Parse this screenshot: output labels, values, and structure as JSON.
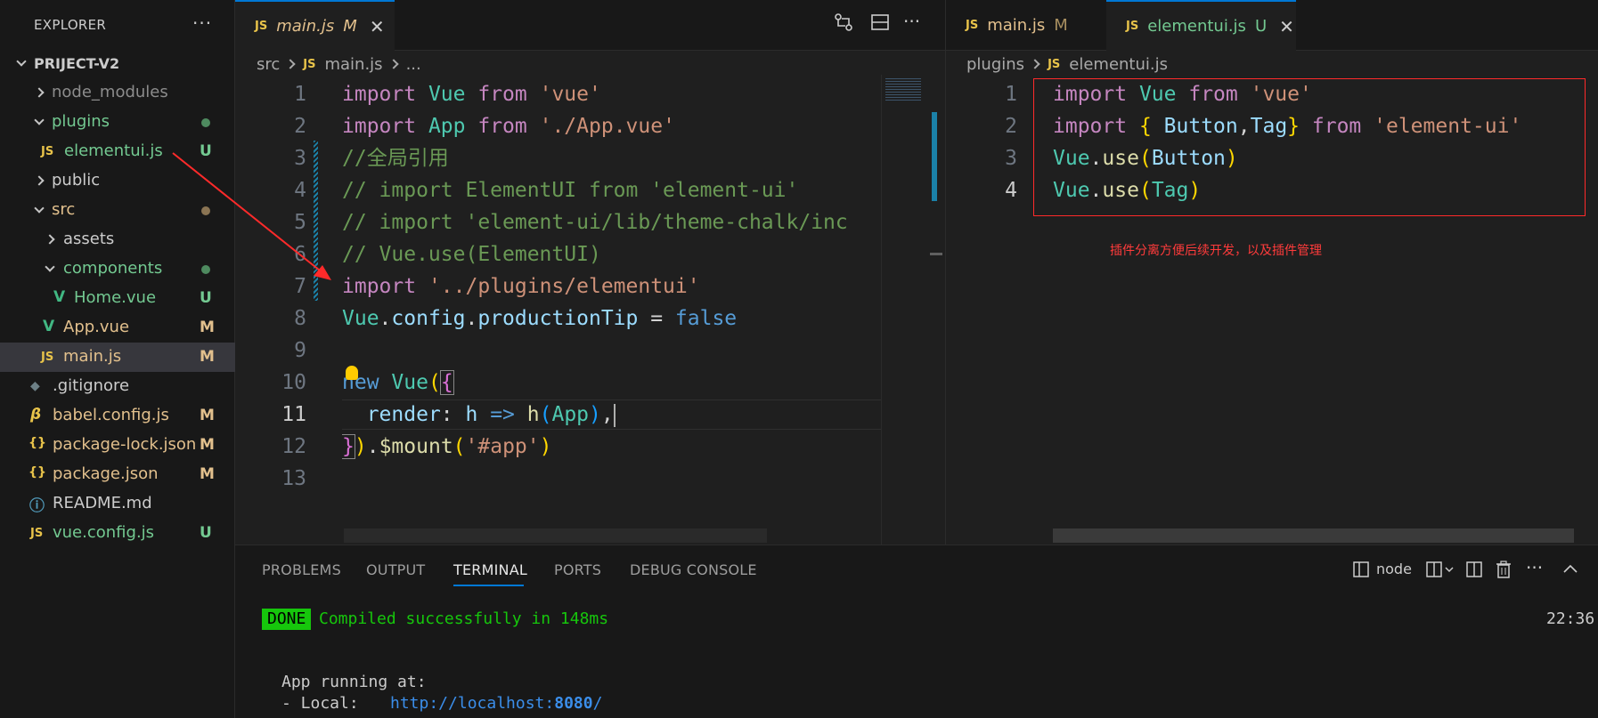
{
  "sidebar": {
    "title": "EXPLORER",
    "more": "···",
    "project": "PRIJECT-V2",
    "items": [
      {
        "label": "node_modules",
        "icon": "chevron-right",
        "status": ""
      },
      {
        "label": "plugins",
        "icon": "chevron-down",
        "status": ""
      },
      {
        "label": "elementui.js",
        "icon": "JS",
        "status": "U"
      },
      {
        "label": "public",
        "icon": "chevron-right",
        "status": ""
      },
      {
        "label": "src",
        "icon": "chevron-down",
        "status": ""
      },
      {
        "label": "assets",
        "icon": "chevron-right",
        "status": ""
      },
      {
        "label": "components",
        "icon": "chevron-down",
        "status": ""
      },
      {
        "label": "Home.vue",
        "icon": "V",
        "status": "U"
      },
      {
        "label": "App.vue",
        "icon": "V",
        "status": "M"
      },
      {
        "label": "main.js",
        "icon": "JS",
        "status": "M"
      },
      {
        "label": ".gitignore",
        "icon": "◆",
        "status": ""
      },
      {
        "label": "babel.config.js",
        "icon": "β",
        "status": "M"
      },
      {
        "label": "package-lock.json",
        "icon": "{}",
        "status": "M"
      },
      {
        "label": "package.json",
        "icon": "{}",
        "status": "M"
      },
      {
        "label": "README.md",
        "icon": "ⓘ",
        "status": ""
      },
      {
        "label": "vue.config.js",
        "icon": "JS",
        "status": "U"
      }
    ]
  },
  "editor1": {
    "tab": {
      "label": "main.js",
      "status": "M",
      "close": "✕",
      "icon": "JS"
    },
    "breadcrumb": {
      "folder": "src",
      "file": "main.js",
      "more": "..."
    },
    "line_numbers": [
      "1",
      "2",
      "3",
      "4",
      "5",
      "6",
      "7",
      "8",
      "9",
      "10",
      "11",
      "12",
      "13"
    ],
    "code": {
      "l1": [
        "import",
        "Vue",
        "from",
        "'vue'"
      ],
      "l2": [
        "import",
        "App",
        "from",
        "'./App.vue'"
      ],
      "l3": "//全局引用",
      "l4": "// import ElementUI from 'element-ui'",
      "l5": "// import 'element-ui/lib/theme-chalk/inc",
      "l6": "// Vue.use(ElementUI)",
      "l7": [
        "import",
        "'../plugins/elementui'"
      ],
      "l8": [
        "Vue",
        ".",
        "config",
        ".",
        "productionTip",
        " = ",
        "false"
      ],
      "l10": [
        "new",
        "Vue",
        "(",
        "{"
      ],
      "l11": [
        "render",
        ": ",
        "h",
        " => ",
        "h",
        "(",
        "App",
        ")",
        ","
      ],
      "l12": [
        "}",
        ")",
        ".",
        "$mount",
        "(",
        "'#app'",
        ")"
      ]
    }
  },
  "editor2": {
    "tabs": [
      {
        "label": "main.js",
        "status": "M",
        "icon": "JS"
      },
      {
        "label": "elementui.js",
        "status": "U",
        "icon": "JS",
        "close": "✕"
      }
    ],
    "breadcrumb": {
      "folder": "plugins",
      "file": "elementui.js"
    },
    "line_numbers": [
      "1",
      "2",
      "3",
      "4"
    ],
    "code": {
      "l1": [
        "import",
        "Vue",
        "from",
        "'vue'"
      ],
      "l2": [
        "import",
        "{",
        "Button",
        ",",
        "Tag",
        "}",
        "from",
        "'element-ui'"
      ],
      "l3": [
        "Vue",
        ".",
        "use",
        "(",
        "Button",
        ")"
      ],
      "l4": [
        "Vue",
        ".",
        "use",
        "(",
        "Tag",
        ")"
      ]
    },
    "annotation": "插件分离方便后续开发，以及插件管理"
  },
  "panel": {
    "tabs": [
      "PROBLEMS",
      "OUTPUT",
      "TERMINAL",
      "PORTS",
      "DEBUG CONSOLE"
    ],
    "active_tab": "TERMINAL",
    "terminal_name": "node",
    "done_badge": "DONE",
    "compiled": "Compiled successfully in 148ms",
    "time": "22:36",
    "running": "App running at:",
    "local_label": "- Local:",
    "local_url_prefix": "http://localhost:",
    "local_port": "8080",
    "local_url_suffix": "/"
  },
  "colors": {
    "accent": "#0078d4",
    "untracked": "#73c991",
    "modified": "#e2c08d",
    "annotation": "#ff3b3b"
  }
}
